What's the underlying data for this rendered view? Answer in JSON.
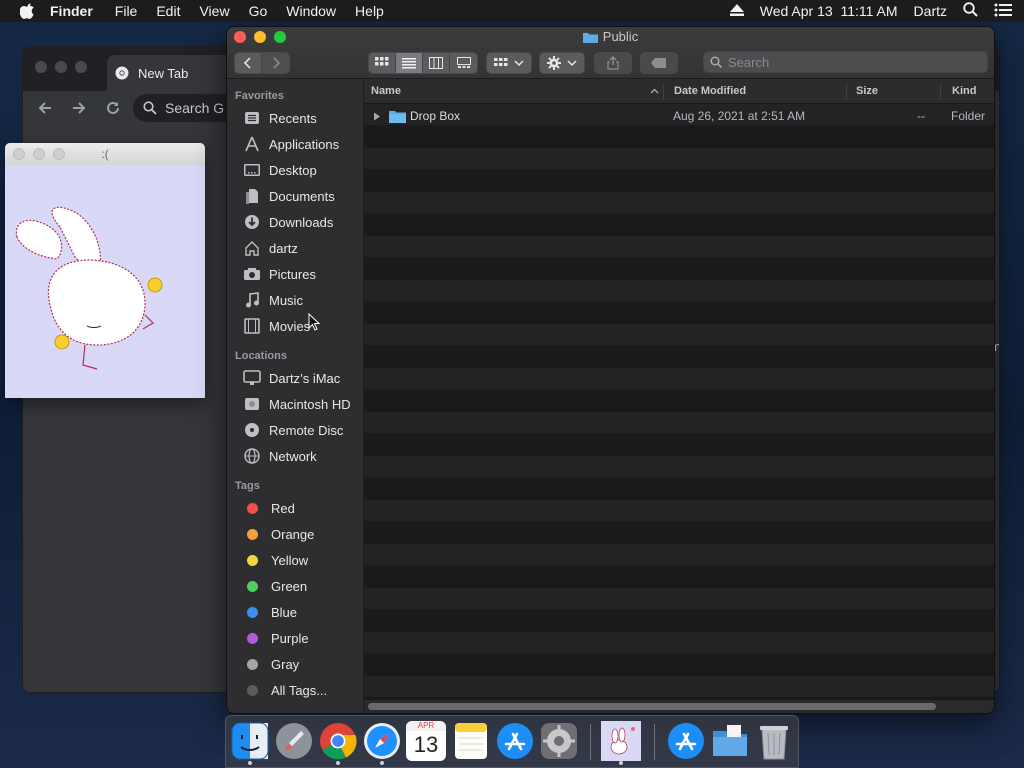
{
  "menubar": {
    "app_name": "Finder",
    "items": [
      "File",
      "Edit",
      "View",
      "Go",
      "Window",
      "Help"
    ],
    "datetime": "Wed Apr 13  11:11 AM",
    "user": "Dartz"
  },
  "chrome": {
    "tab_title": "New Tab",
    "omnibox_text": "Search G",
    "fragment_text": "m"
  },
  "mini_window": {
    "title": ":("
  },
  "finder": {
    "title": "Public",
    "search_placeholder": "Search",
    "sidebar": {
      "favorites_header": "Favorites",
      "favorites": [
        {
          "label": "Recents",
          "icon": "recents-icon"
        },
        {
          "label": "Applications",
          "icon": "applications-icon"
        },
        {
          "label": "Desktop",
          "icon": "desktop-icon"
        },
        {
          "label": "Documents",
          "icon": "documents-icon"
        },
        {
          "label": "Downloads",
          "icon": "downloads-icon"
        },
        {
          "label": "dartz",
          "icon": "home-icon"
        },
        {
          "label": "Pictures",
          "icon": "pictures-icon"
        },
        {
          "label": "Music",
          "icon": "music-icon"
        },
        {
          "label": "Movies",
          "icon": "movies-icon"
        }
      ],
      "locations_header": "Locations",
      "locations": [
        {
          "label": "Dartz’s iMac",
          "icon": "imac-icon"
        },
        {
          "label": "Macintosh HD",
          "icon": "disk-icon"
        },
        {
          "label": "Remote Disc",
          "icon": "disc-icon"
        },
        {
          "label": "Network",
          "icon": "network-icon"
        }
      ],
      "tags_header": "Tags",
      "tags": [
        {
          "label": "Red",
          "color": "#f0504a"
        },
        {
          "label": "Orange",
          "color": "#f5a03a"
        },
        {
          "label": "Yellow",
          "color": "#f6d43c"
        },
        {
          "label": "Green",
          "color": "#4cd05a"
        },
        {
          "label": "Blue",
          "color": "#3a8ff5"
        },
        {
          "label": "Purple",
          "color": "#b05ae0"
        },
        {
          "label": "Gray",
          "color": "#a5a5a8"
        },
        {
          "label": "All Tags...",
          "color": "#5a5a5d"
        }
      ]
    },
    "columns": {
      "name": "Name",
      "date_modified": "Date Modified",
      "size": "Size",
      "kind": "Kind"
    },
    "files": [
      {
        "name": "Drop Box",
        "date_modified": "Aug 26, 2021 at 2:51 AM",
        "size": "--",
        "kind": "Folder"
      }
    ]
  },
  "dock": {
    "calendar_month": "APR",
    "calendar_day": "13",
    "apps": [
      "finder-icon",
      "launchpad-icon",
      "chrome-icon",
      "safari-icon",
      "calendar-icon",
      "notes-icon",
      "app-store-icon",
      "system-preferences-icon",
      "bunny-app-icon",
      "app-store-icon",
      "folder-icon",
      "trash-icon"
    ]
  }
}
